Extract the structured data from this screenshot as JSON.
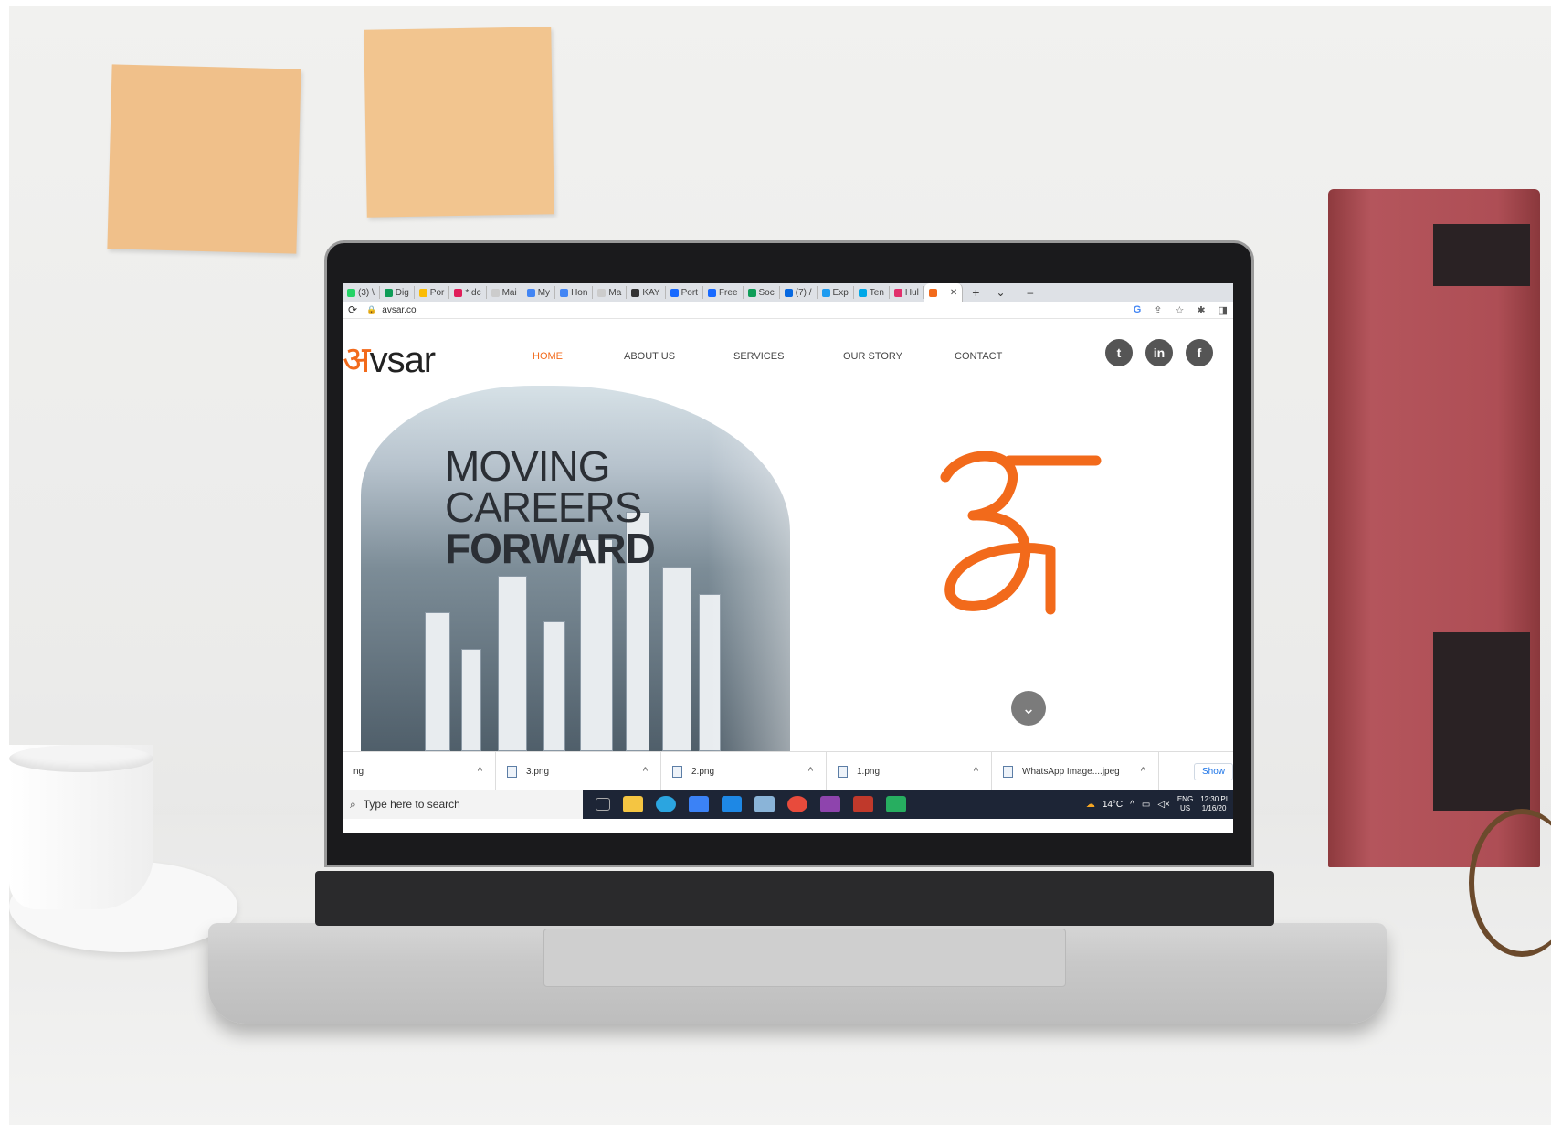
{
  "browser": {
    "tabs": [
      {
        "label": "(3) \\",
        "color": "#25d366"
      },
      {
        "label": "Dig",
        "color": "#0f9d58"
      },
      {
        "label": "Por",
        "color": "#fbbc04"
      },
      {
        "label": "* dc",
        "color": "#e01e5a"
      },
      {
        "label": "Mai",
        "color": "#cccccc"
      },
      {
        "label": "My",
        "color": "#4285f4"
      },
      {
        "label": "Hon",
        "color": "#4285f4"
      },
      {
        "label": "Ma",
        "color": "#cccccc"
      },
      {
        "label": "KAY",
        "color": "#333333"
      },
      {
        "label": "Port",
        "color": "#1769ff"
      },
      {
        "label": "Free",
        "color": "#1769ff"
      },
      {
        "label": "Soc",
        "color": "#0f9d58"
      },
      {
        "label": "(7) /",
        "color": "#0668e1"
      },
      {
        "label": "Exp",
        "color": "#1d9bf0"
      },
      {
        "label": "Ten",
        "color": "#00a8e8"
      },
      {
        "label": "Hul",
        "color": "#e1306c"
      },
      {
        "label": "",
        "color": "#f26a1b",
        "active": true
      }
    ],
    "new_tab": "+",
    "close_glyph": "✕",
    "url": "avsar.co"
  },
  "site": {
    "logo_text": "vsar",
    "logo_mark": "अ",
    "nav": [
      "HOME",
      "ABOUT US",
      "SERVICES",
      "OUR STORY",
      "CONTACT"
    ],
    "social": [
      {
        "name": "twitter",
        "glyph": "t"
      },
      {
        "name": "linkedin",
        "glyph": "in"
      },
      {
        "name": "facebook",
        "glyph": "f"
      }
    ],
    "hero": {
      "line1": "MOVING",
      "line2": "CAREERS",
      "line3": "FORWARD"
    },
    "accent": "#f26a1b"
  },
  "downloads": {
    "items": [
      "ng",
      "3.png",
      "2.png",
      "1.png",
      "WhatsApp Image....jpeg"
    ],
    "show_all": "Show"
  },
  "taskbar": {
    "search_placeholder": "Type here to search",
    "temperature": "14°C",
    "lang_top": "ENG",
    "lang_bottom": "US",
    "time": "12:30 PI",
    "date": "1/16/20"
  }
}
